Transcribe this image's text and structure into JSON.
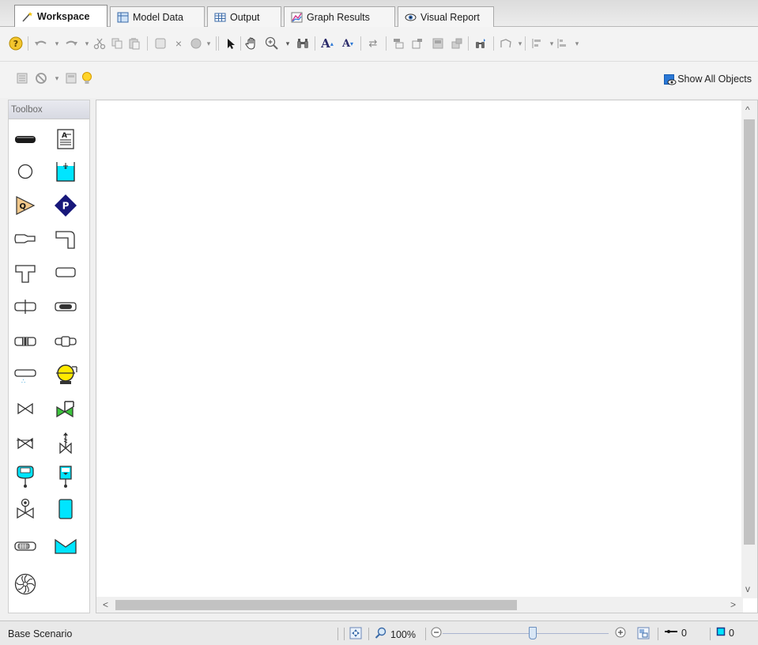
{
  "tabs": [
    {
      "label": "Workspace",
      "icon": "workspace-wand-icon",
      "active": true
    },
    {
      "label": "Model Data",
      "icon": "model-data-icon",
      "active": false
    },
    {
      "label": "Output",
      "icon": "output-table-icon",
      "active": false
    },
    {
      "label": "Graph Results",
      "icon": "graph-results-icon",
      "active": false
    },
    {
      "label": "Visual Report",
      "icon": "visual-report-eye-icon",
      "active": false
    }
  ],
  "toolbar2": {
    "show_all_label": "Show All Objects"
  },
  "toolbox": {
    "title": "Toolbox"
  },
  "status": {
    "scenario": "Base Scenario",
    "zoom": "100%",
    "pipe_count": "0",
    "junction_count": "0"
  },
  "colors": {
    "accent_blue": "#2a78d6",
    "cyan": "#00e5ff",
    "navy": "#17177a",
    "tan": "#f1c78a",
    "yellow": "#ffea00"
  }
}
